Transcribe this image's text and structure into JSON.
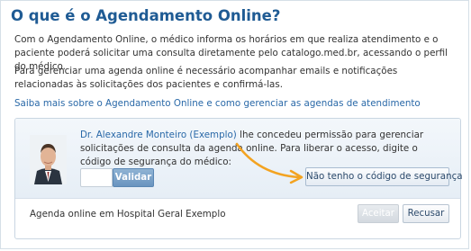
{
  "page": {
    "title": "O que é o Agendamento Online?",
    "paragraph1": "Com o Agendamento Online, o médico informa os horários em que realiza atendimento e o paciente poderá solicitar uma consulta diretamente pelo catalogo.med.br, acessando o perfil do médico.",
    "paragraph2": "Para gerenciar uma agenda online é necessário acompanhar emails e notificações relacionadas às solicitações dos pacientes e confirmá-las.",
    "learn_more": "Saiba mais sobre o Agendamento Online e como gerenciar as agendas de atendimento"
  },
  "card": {
    "doctor_name": "Dr. Alexandre Monteiro (Exemplo)",
    "permission_text": " lhe concedeu permissão para gerenciar solicitações de consulta da agenda online. Para liberar o acesso, digite o código de segurança do médico:",
    "code_value": "",
    "validate_label": "Validar",
    "no_code_label": "Não tenho o código de segurança",
    "agenda_label": "Agenda online em Hospital Geral Exemplo",
    "accept_label": "Aceitar",
    "refuse_label": "Recusar"
  },
  "colors": {
    "title": "#1f5b94",
    "link": "#2a69a8",
    "arrow": "#f3a321",
    "validate_bg": "#6a94bf"
  },
  "icons": {
    "doctor_photo": "doctor-avatar",
    "arrow": "curved-arrow"
  }
}
